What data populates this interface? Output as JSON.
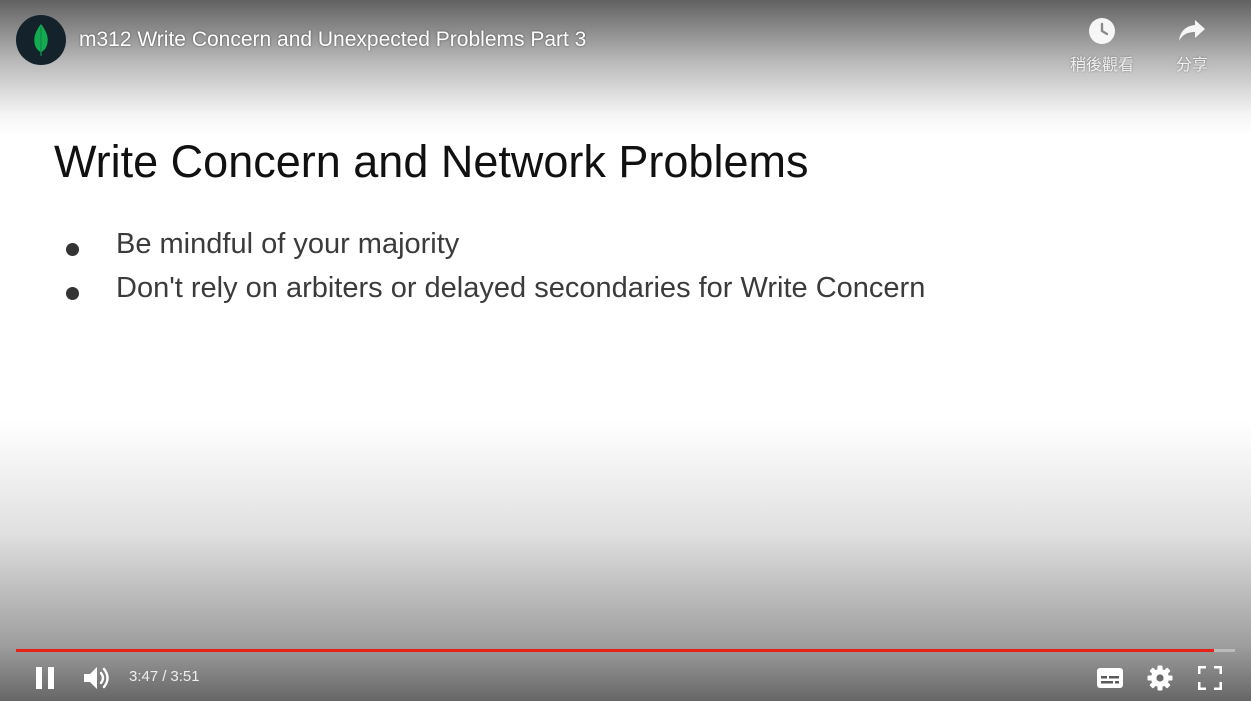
{
  "video": {
    "title": "m312 Write Concern and Unexpected Problems Part 3",
    "channel_avatar_icon": "mongodb-leaf-icon"
  },
  "top_actions": {
    "watch_later": {
      "label": "稍後觀看",
      "icon": "clock-icon"
    },
    "share": {
      "label": "分享",
      "icon": "share-arrow-icon"
    }
  },
  "slide": {
    "title": "Write Concern and Network Problems",
    "bullets": [
      "Be mindful of your majority",
      "Don't rely on arbiters or delayed secondaries for Write Concern"
    ]
  },
  "controls": {
    "current_time": "3:47",
    "time_separator": "/",
    "duration": "3:51",
    "progress": 0.983,
    "progress_color": "#e62117",
    "buttons": [
      "pause-icon",
      "volume-icon",
      "subtitles-icon",
      "settings-gear-icon",
      "fullscreen-icon"
    ]
  }
}
